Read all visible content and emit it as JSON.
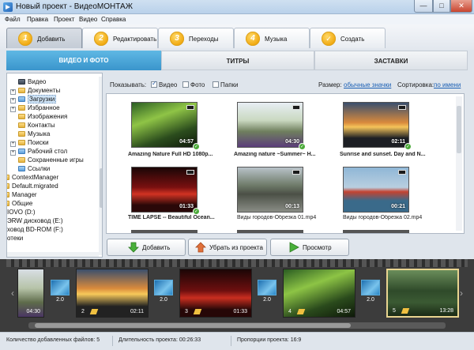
{
  "window": {
    "title": "Новый проект - ВидеоМОНТАЖ"
  },
  "menu": [
    "Файл",
    "Правка",
    "Проект",
    "Видео",
    "Справка"
  ],
  "steps": [
    {
      "num": "1",
      "label": "Добавить"
    },
    {
      "num": "2",
      "label": "Редактировать"
    },
    {
      "num": "3",
      "label": "Переходы"
    },
    {
      "num": "4",
      "label": "Музыка"
    },
    {
      "num": "✓",
      "label": "Создать"
    }
  ],
  "subtabs": [
    "ВИДЕО И ФОТО",
    "ТИТРЫ",
    "ЗАСТАВКИ"
  ],
  "tree": [
    {
      "label": "Видео",
      "exp": ""
    },
    {
      "label": "Документы",
      "exp": "+"
    },
    {
      "label": "Загрузки",
      "exp": "+"
    },
    {
      "label": "Избранное",
      "exp": "+"
    },
    {
      "label": "Изображения",
      "exp": ""
    },
    {
      "label": "Контакты",
      "exp": ""
    },
    {
      "label": "Музыка",
      "exp": ""
    },
    {
      "label": "Поиски",
      "exp": "+"
    },
    {
      "label": "Рабочий стол",
      "exp": "+"
    },
    {
      "label": "Сохраненные игры",
      "exp": ""
    },
    {
      "label": "Ссылки",
      "exp": ""
    },
    {
      "label": "ContextManager",
      "exp": ""
    },
    {
      "label": "Default.migrated",
      "exp": ""
    },
    {
      "label": "Manager",
      "exp": ""
    },
    {
      "label": "Общие",
      "exp": ""
    },
    {
      "label": "IOVO (D:)",
      "exp": ""
    },
    {
      "label": "ЭRW дисковод (E:)",
      "exp": ""
    },
    {
      "label": "ховод BD-ROM (F:)",
      "exp": ""
    },
    {
      "label": "отеки",
      "exp": ""
    }
  ],
  "toolbar": {
    "show_label": "Показывать:",
    "filters": [
      {
        "label": "Видео",
        "checked": true
      },
      {
        "label": "Фото",
        "checked": false
      },
      {
        "label": "Папки",
        "checked": false
      }
    ],
    "size_label": "Размер:",
    "size_value": "обычные значки",
    "sort_label": "Сортировка:",
    "sort_value": "по имени"
  },
  "files": [
    {
      "name": "Amazing Nature Full HD 1080p...",
      "duration": "04:57",
      "bold": true,
      "added": true
    },
    {
      "name": "Amazing nature ~Summer~ H...",
      "duration": "04:30",
      "bold": true,
      "added": true
    },
    {
      "name": "Sunrise and sunset. Day and N...",
      "duration": "02:11",
      "bold": true,
      "added": true
    },
    {
      "name": "TIME LAPSE -- Beautiful Ocean...",
      "duration": "01:33",
      "bold": true,
      "added": true
    },
    {
      "name": "Виды городов-Обрезка 01.mp4",
      "duration": "00:13",
      "bold": false,
      "added": false
    },
    {
      "name": "Виды городов-Обрезка 02.mp4",
      "duration": "00:21",
      "bold": false,
      "added": false
    }
  ],
  "actions": {
    "add": "Добавить",
    "remove": "Убрать из проекта",
    "preview": "Просмотр"
  },
  "timeline": {
    "clips": [
      {
        "num": "",
        "duration": "04:30"
      },
      {
        "num": "2",
        "duration": "02:11"
      },
      {
        "num": "3",
        "duration": "01:33"
      },
      {
        "num": "4",
        "duration": "04:57"
      },
      {
        "num": "5",
        "duration": "13:28"
      }
    ],
    "transitions": [
      "2.0",
      "2.0",
      "2.0",
      "2.0",
      "2.0"
    ]
  },
  "status": {
    "files_count": "Количество добавленных файлов: 5",
    "duration": "Длительность проекта:  00:26:33",
    "ratio": "Пропорции проекта:  16:9"
  },
  "colors": {
    "accent": "#3a95cc",
    "step_badge": "#f0a70d",
    "added_check": "#4caa3a"
  }
}
